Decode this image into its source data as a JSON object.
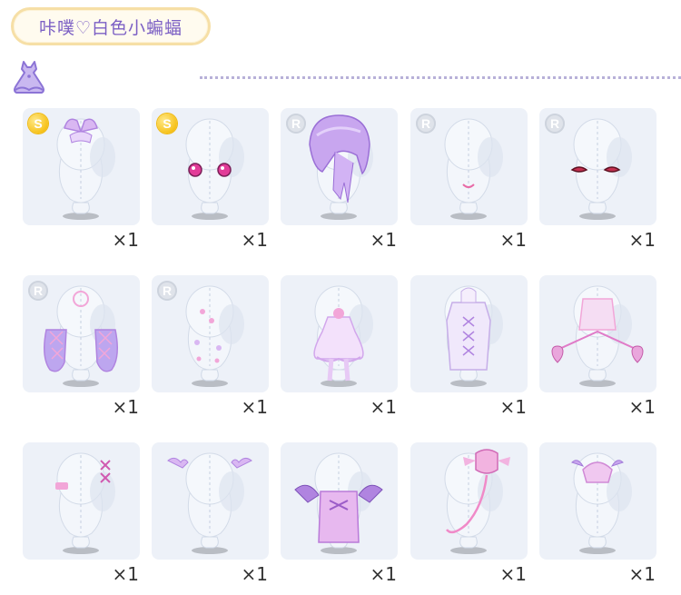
{
  "header": {
    "title": "咔噗♡白色小蝙蝠"
  },
  "section": {
    "icon": "dress-icon"
  },
  "colors": {
    "accent": "#7b5fc4",
    "card_bg": "#edf1f8",
    "badge_gold": "#f7c21a",
    "badge_grey": "#dfe3ea",
    "item_tint": "#d9b7f2"
  },
  "items": [
    {
      "rarity": "S",
      "qty": "×1",
      "kind": "headwear-bow"
    },
    {
      "rarity": "S",
      "qty": "×1",
      "kind": "eyes-pink"
    },
    {
      "rarity": "R",
      "qty": "×1",
      "kind": "hair-purple-bob"
    },
    {
      "rarity": "R",
      "qty": "×1",
      "kind": "mouth-smile"
    },
    {
      "rarity": "R",
      "qty": "×1",
      "kind": "eyes-red"
    },
    {
      "rarity": "R",
      "qty": "×1",
      "kind": "gloves-ruffle"
    },
    {
      "rarity": "R",
      "qty": "×1",
      "kind": "body-accessory-beads"
    },
    {
      "rarity": "",
      "qty": "×1",
      "kind": "dress-lolita"
    },
    {
      "rarity": "",
      "qty": "×1",
      "kind": "coat-laced"
    },
    {
      "rarity": "",
      "qty": "×1",
      "kind": "bag-heart-chain"
    },
    {
      "rarity": "",
      "qty": "×1",
      "kind": "face-patches-cross"
    },
    {
      "rarity": "",
      "qty": "×1",
      "kind": "bat-wing-hairpins"
    },
    {
      "rarity": "",
      "qty": "×1",
      "kind": "boots-bat-wing"
    },
    {
      "rarity": "",
      "qty": "×1",
      "kind": "bat-balloon"
    },
    {
      "rarity": "",
      "qty": "×1",
      "kind": "bat-hat"
    }
  ]
}
